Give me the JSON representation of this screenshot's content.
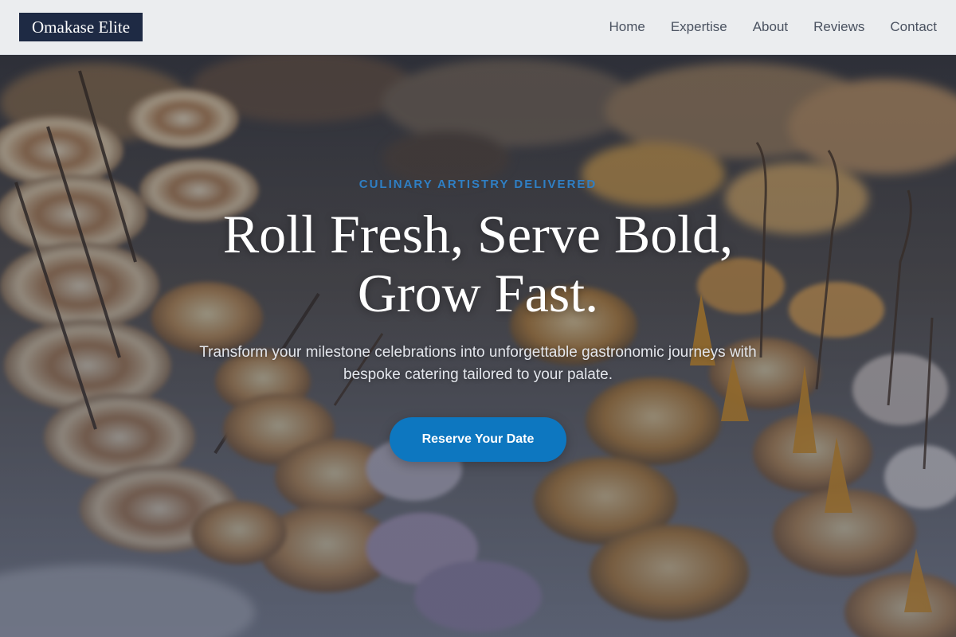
{
  "header": {
    "logo": "Omakase Elite",
    "nav": [
      {
        "label": "Home"
      },
      {
        "label": "Expertise"
      },
      {
        "label": "About"
      },
      {
        "label": "Reviews"
      },
      {
        "label": "Contact"
      }
    ]
  },
  "hero": {
    "eyebrow": "CULINARY ARTISTRY DELIVERED",
    "headline_line1": "Roll Fresh, Serve Bold,",
    "headline_line2": "Grow Fast.",
    "subhead": "Transform your milestone celebrations into unforgettable gastronomic journeys with bespoke catering tailored to your palate.",
    "cta_label": "Reserve Your Date"
  },
  "colors": {
    "logo_bg": "#1e2a44",
    "accent": "#0d77c0",
    "eyebrow": "#2f7fc4"
  }
}
